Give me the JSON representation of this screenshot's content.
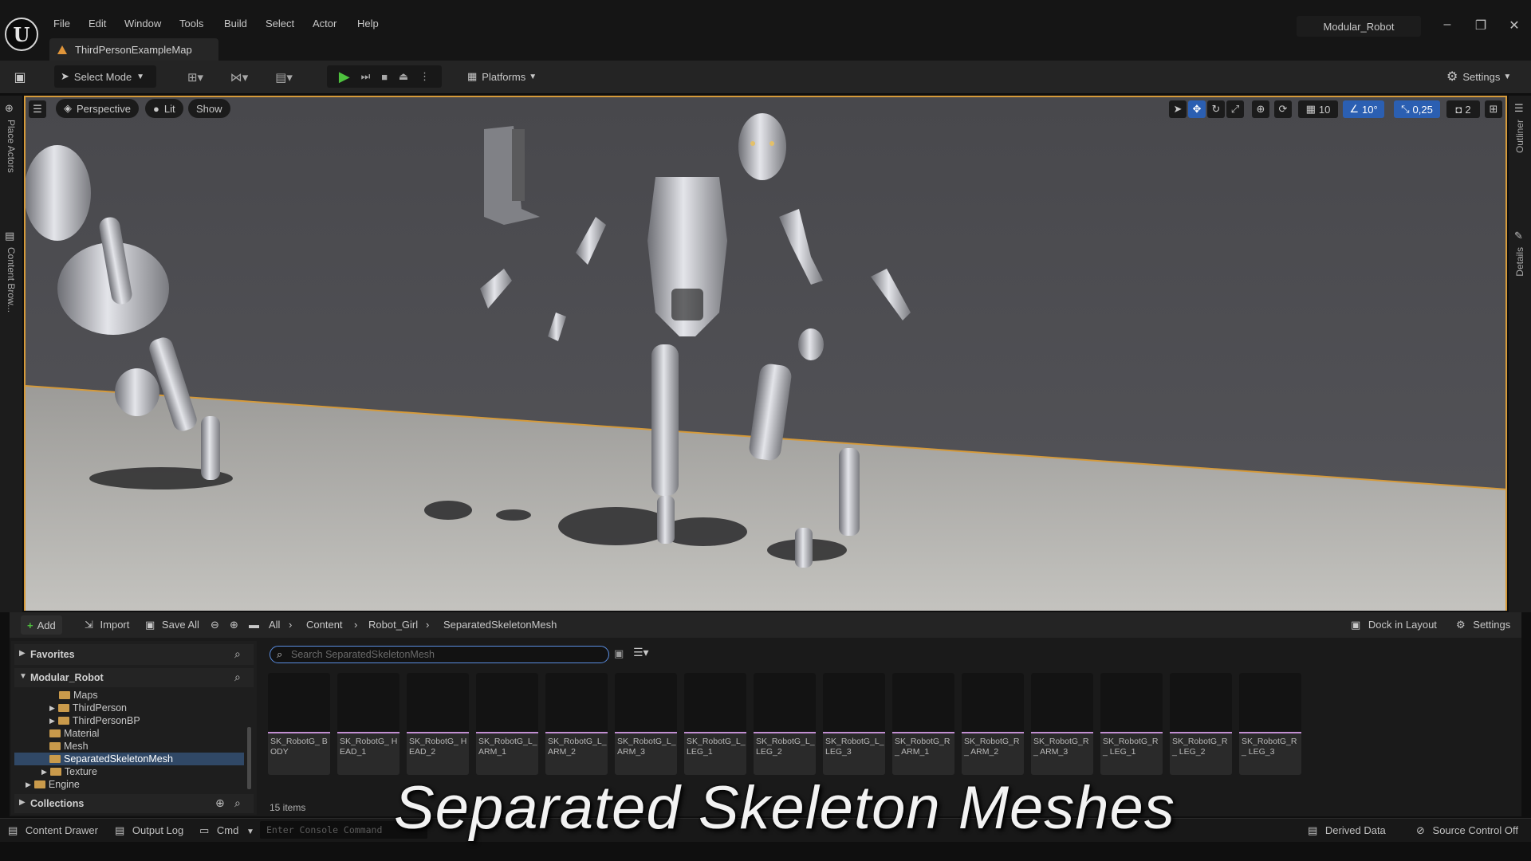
{
  "menu": [
    "File",
    "Edit",
    "Window",
    "Tools",
    "Build",
    "Select",
    "Actor",
    "Help"
  ],
  "project_name": "Modular_Robot",
  "map_tab": "ThirdPersonExampleMap",
  "toolbar": {
    "select_mode": "Select Mode",
    "platforms": "Platforms",
    "settings": "Settings"
  },
  "viewport": {
    "perspective": "Perspective",
    "lit": "Lit",
    "show": "Show",
    "grid_snap": "10",
    "rotation_snap": "10°",
    "scale_snap": "0,25",
    "camera_speed": "2"
  },
  "side_tabs": {
    "place_actors": "Place Actors",
    "content_browser": "Content Brow...",
    "outliner": "Outliner",
    "details": "Details"
  },
  "drawer": {
    "add": "Add",
    "import": "Import",
    "save_all": "Save All",
    "breadcrumb": [
      "All",
      "Content",
      "Robot_Girl",
      "SeparatedSkeletonMesh"
    ],
    "dock": "Dock in Layout",
    "settings": "Settings",
    "favorites": "Favorites",
    "root": "Modular_Robot",
    "collections": "Collections",
    "search_placeholder": "Search SeparatedSkeletonMesh",
    "item_count": "15 items",
    "tree": [
      "Maps",
      "ThirdPerson",
      "ThirdPersonBP",
      "Material",
      "Mesh",
      "SeparatedSkeletonMesh",
      "Texture",
      "Engine"
    ],
    "assets": [
      "SK_RobotG_ BODY",
      "SK_RobotG_ HEAD_1",
      "SK_RobotG_ HEAD_2",
      "SK_RobotG_L_ ARM_1",
      "SK_RobotG_L_ ARM_2",
      "SK_RobotG_L_ ARM_3",
      "SK_RobotG_L_ LEG_1",
      "SK_RobotG_L_ LEG_2",
      "SK_RobotG_L_ LEG_3",
      "SK_RobotG_R_ ARM_1",
      "SK_RobotG_R_ ARM_2",
      "SK_RobotG_R_ ARM_3",
      "SK_RobotG_R_ LEG_1",
      "SK_RobotG_R_ LEG_2",
      "SK_RobotG_R_ LEG_3"
    ]
  },
  "status": {
    "content_drawer": "Content Drawer",
    "output_log": "Output Log",
    "cmd": "Cmd",
    "console_placeholder": "Enter Console Command",
    "derived_data": "Derived Data",
    "source_control": "Source Control Off"
  },
  "caption": "Separated Skeleton Meshes"
}
